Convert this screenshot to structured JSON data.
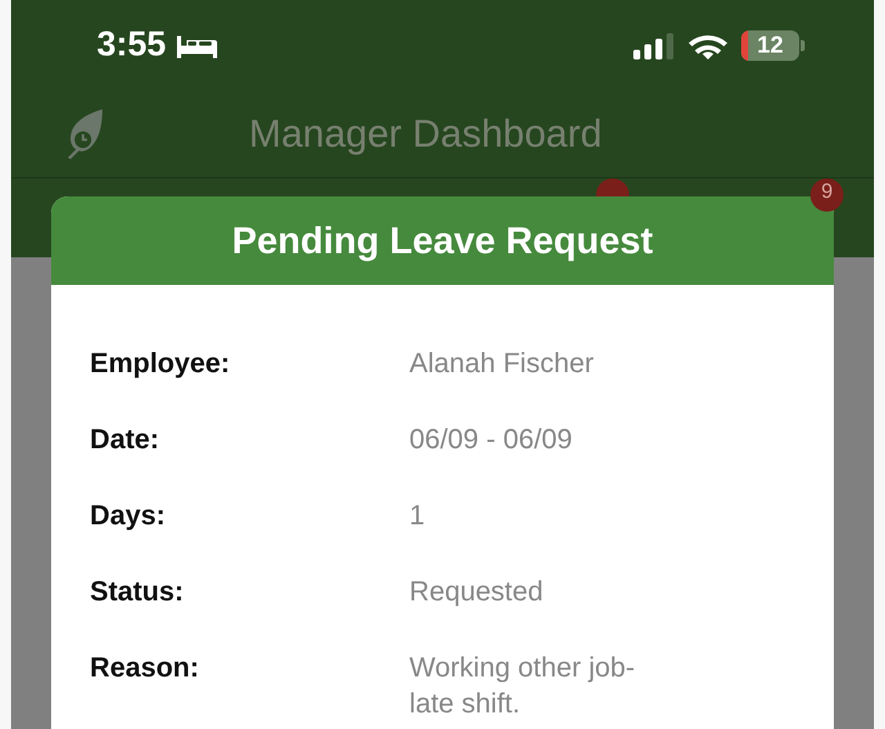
{
  "status_bar": {
    "time": "3:55",
    "battery": "12"
  },
  "nav": {
    "title": "Manager Dashboard"
  },
  "tabs": [
    {
      "badge": "9"
    }
  ],
  "dialog": {
    "title": "Pending Leave Request",
    "fields": [
      {
        "label": "Employee:",
        "value": "Alanah Fischer"
      },
      {
        "label": "Date:",
        "value": "06/09 - 06/09"
      },
      {
        "label": "Days:",
        "value": "1"
      },
      {
        "label": "Status:",
        "value": "Requested"
      },
      {
        "label": "Reason:",
        "value": "Working other job- late shift."
      }
    ]
  }
}
